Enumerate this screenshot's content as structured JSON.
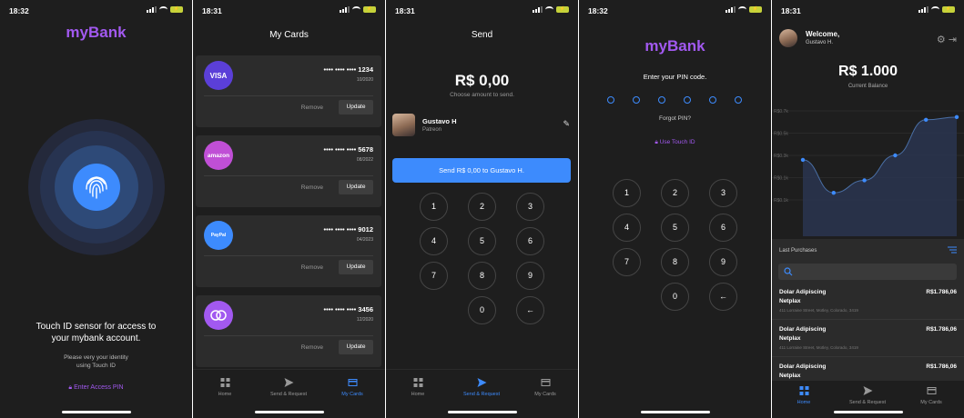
{
  "status": {
    "time_1": "18:32",
    "time_2": "18:31",
    "time_3": "18:31",
    "time_4": "18:32",
    "time_5": "18:31"
  },
  "colors": {
    "brand": "#a259f0",
    "accent": "#3d8bfd",
    "background": "#1e1e1e",
    "card": "#2c2c2c"
  },
  "touch_id": {
    "brand": "myBank",
    "title_line1": "Touch ID sensor for access to",
    "title_line2": "your mybank account.",
    "subtitle_line1": "Please very your identity",
    "subtitle_line2": "using Touch ID",
    "pin_link": "Enter Access PIN",
    "icon": "fingerprint-icon"
  },
  "my_cards": {
    "title": "My Cards",
    "remove_label": "Remove",
    "update_label": "Update",
    "cards": [
      {
        "logo": "VISA",
        "number": "•••• •••• •••• 1234",
        "expiry": "10/2020",
        "color": "#5b3fd8"
      },
      {
        "logo": "amazon",
        "number": "•••• •••• •••• 5678",
        "expiry": "08/2022",
        "color": "#c04fd6"
      },
      {
        "logo": "PayPal",
        "number": "•••• •••• •••• 9012",
        "expiry": "04/2023",
        "color": "#3d8bfd"
      },
      {
        "logo": "mastercard",
        "number": "•••• •••• •••• 3456",
        "expiry": "12/2020",
        "color": "#a259f0"
      }
    ]
  },
  "tabs": {
    "home": "Home",
    "send": "Send & Request",
    "cards": "My Cards"
  },
  "send": {
    "title": "Send",
    "amount": "R$ 0,00",
    "amount_sub": "Choose amount to send.",
    "recipient_name": "Gustavo H",
    "recipient_role": "Patreon",
    "button": "Send R$ 0,00 to Gustavo H.",
    "keys": [
      "1",
      "2",
      "3",
      "4",
      "5",
      "6",
      "7",
      "8",
      "9",
      "0",
      "←"
    ]
  },
  "pin": {
    "brand": "myBank",
    "label": "Enter your PIN code.",
    "forgot": "Forgot PIN?",
    "touch_link": "Use Touch ID",
    "digits_total": 6,
    "keys": [
      "1",
      "2",
      "3",
      "4",
      "5",
      "6",
      "7",
      "8",
      "9",
      "0",
      "←"
    ]
  },
  "dashboard": {
    "welcome": "Welcome,",
    "user": "Gustavo H.",
    "balance": "R$ 1.000",
    "balance_sub": "Current Balance",
    "purchases_title": "Last Purchases",
    "purchases": [
      {
        "title": "Dolar Adipiscing",
        "merchant": "Netplax",
        "address": "411 Lorraine Street, Motley, Colorado, 3419",
        "amount": "R$1.786,06"
      },
      {
        "title": "Dolar Adipiscing",
        "merchant": "Netplax",
        "address": "411 Lorraine Street, Motley, Colorado, 3419",
        "amount": "R$1.786,06"
      },
      {
        "title": "Dolar Adipiscing",
        "merchant": "Netplax",
        "address": "",
        "amount": "R$1.786,06"
      }
    ]
  },
  "chart_data": {
    "type": "area",
    "ylabels": [
      "R$0.7k",
      "R$0.5k",
      "R$0.3k",
      "R$0.1k",
      "R$0.1k"
    ],
    "values": [
      0.45,
      0.08,
      0.22,
      0.5,
      0.9,
      0.93
    ],
    "ylim": [
      0,
      1
    ],
    "grid": true
  }
}
